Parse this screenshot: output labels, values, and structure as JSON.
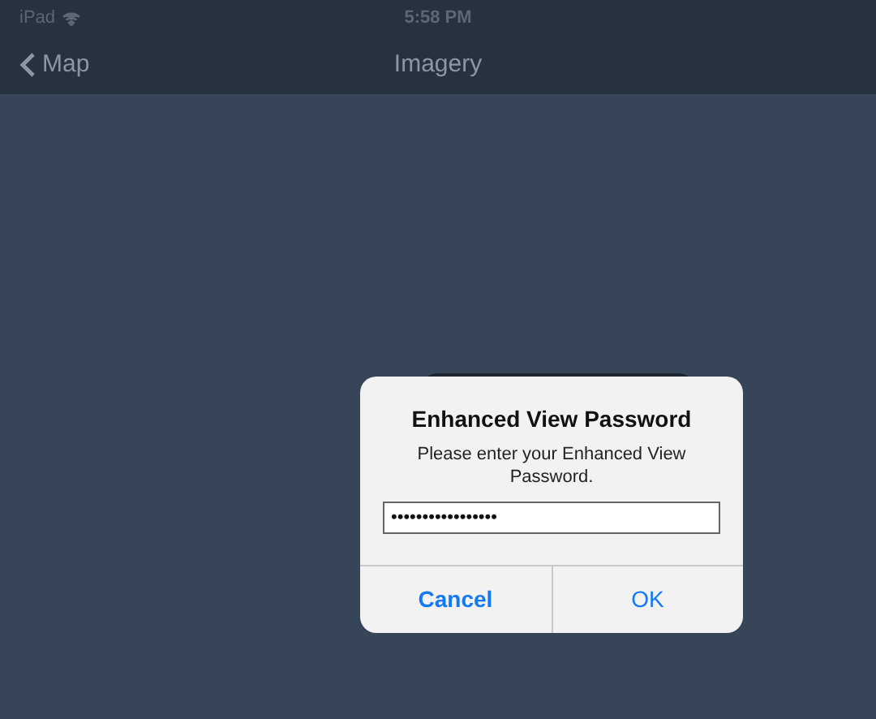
{
  "status_bar": {
    "device": "iPad",
    "time": "5:58 PM"
  },
  "nav_bar": {
    "back_label": "Map",
    "title": "Imagery"
  },
  "dialog": {
    "title": "Enhanced View Password",
    "message": "Please enter your Enhanced View Password.",
    "password_field": {
      "value": "•••••••••••••••••"
    },
    "buttons": [
      {
        "label": "Cancel",
        "kind": "cancel"
      },
      {
        "label": "OK",
        "kind": "default"
      }
    ]
  }
}
